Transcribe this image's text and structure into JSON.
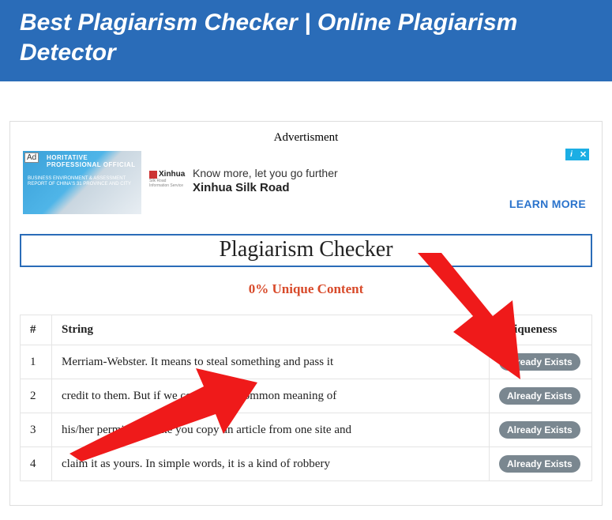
{
  "header": {
    "title": "Best Plagiarism Checker | Online Plagiarism Detector"
  },
  "ad": {
    "top_label": "Advertisment",
    "badge": "Ad",
    "thumb_headline": "HORITATIVE PROFESSIONAL OFFICIAL",
    "thumb_sub": "BUSINESS ENVIRONMENT & ASSESSMENT REPORT OF CHINA'S 31 PROVINCE AND CITY",
    "logo_text": "Xinhua",
    "logo_sub": "Silk Road Information Service",
    "line1": "Know more, let you go further",
    "line2": "Xinhua Silk Road",
    "learn_more": "LEARN MORE",
    "adchoice_i": "i",
    "adchoice_x": "X"
  },
  "section": {
    "title": "Plagiarism Checker",
    "unique_line": "0% Unique Content"
  },
  "table": {
    "col_num": "#",
    "col_string": "String",
    "col_unique": "Uniqueness",
    "badge_label": "Already Exists",
    "rows": [
      {
        "n": "1",
        "s": "Merriam-Webster. It means to steal something and pass it"
      },
      {
        "n": "2",
        "s": "credit to them. But if we come to the common meaning of"
      },
      {
        "n": "3",
        "s": "his/her permission, like you copy an article from one site and"
      },
      {
        "n": "4",
        "s": "claim it as yours. In simple words, it is a kind of robbery"
      }
    ]
  }
}
